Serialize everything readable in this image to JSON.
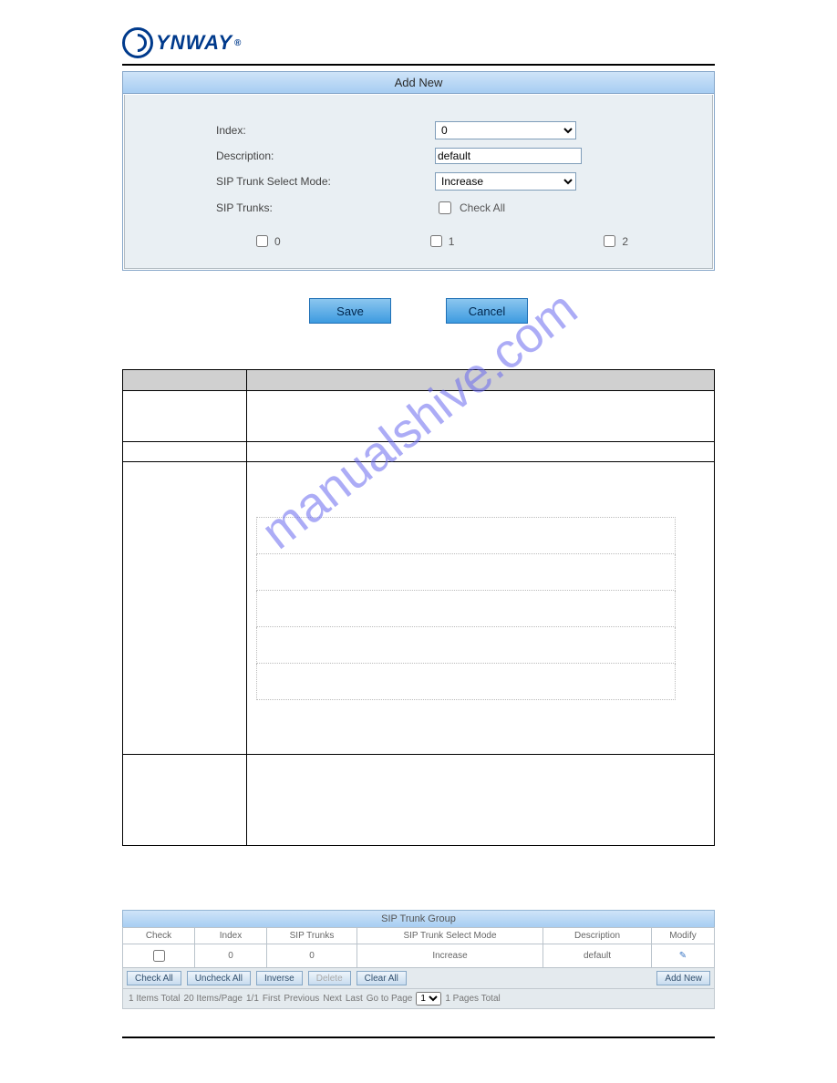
{
  "logo": {
    "text": "YNWAY",
    "reg": "®"
  },
  "watermark": "manualshive.com",
  "addNew": {
    "title": "Add New",
    "labels": {
      "index": "Index:",
      "description": "Description:",
      "selectMode": "SIP Trunk Select Mode:",
      "trunks": "SIP Trunks:"
    },
    "fields": {
      "indexValue": "0",
      "descriptionValue": "default",
      "selectModeValue": "Increase",
      "checkAll": "Check All",
      "trunkOptions": [
        "0",
        "1",
        "2"
      ]
    },
    "buttons": {
      "save": "Save",
      "cancel": "Cancel"
    }
  },
  "trunkGroup": {
    "title": "SIP Trunk Group",
    "headers": {
      "check": "Check",
      "index": "Index",
      "sipTrunks": "SIP Trunks",
      "selectMode": "SIP Trunk Select Mode",
      "description": "Description",
      "modify": "Modify"
    },
    "row": {
      "index": "0",
      "sipTrunks": "0",
      "selectMode": "Increase",
      "description": "default",
      "modifyIcon": "✎"
    },
    "controls": {
      "checkAll": "Check All",
      "uncheckAll": "Uncheck All",
      "inverse": "Inverse",
      "delete": "Delete",
      "clearAll": "Clear All",
      "addNew": "Add New"
    },
    "pager": {
      "itemsTotal": "1 Items Total",
      "perPage": "20 Items/Page",
      "pageFrac": "1/1",
      "first": "First",
      "previous": "Previous",
      "next": "Next",
      "last": "Last",
      "gotoLabel": "Go to Page",
      "gotoValue": "1",
      "pagesTotal": "1 Pages Total"
    }
  }
}
